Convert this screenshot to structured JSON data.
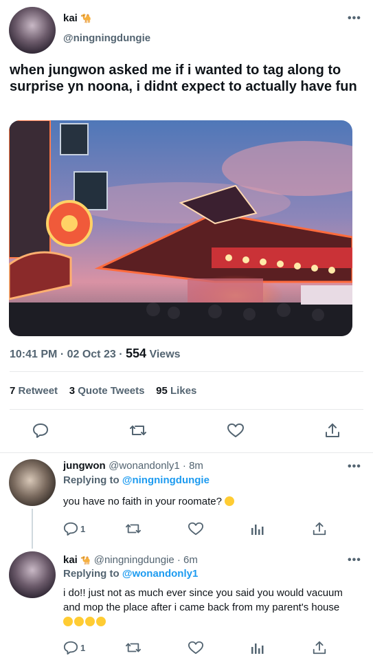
{
  "main_tweet": {
    "display_name": "kai",
    "name_emoji": "🐪",
    "handle": "@ningningdungie",
    "text": "when jungwon asked me if i wanted to tag along to surprise yn noona, i didnt expect to actually have fun",
    "time": "10:41 PM · 02 Oct 23 ·",
    "views_count": "554",
    "views_label": "Views",
    "retweets_count": "7",
    "retweets_label": "Retweet",
    "quotes_count": "3",
    "quotes_label": "Quote Tweets",
    "likes_count": "95",
    "likes_label": "Likes"
  },
  "replies": [
    {
      "display_name": "jungwon",
      "handle_time": "@wonandonly1 · 8m",
      "replying_prefix": "Replying to",
      "replying_to": "@ningningdungie",
      "text": "you have no faith in your roomate?",
      "reply_count": "1"
    },
    {
      "display_name": "kai",
      "name_emoji": "🐪",
      "handle_time": "@ningningdungie · 6m",
      "replying_prefix": "Replying to",
      "replying_to": "@wonandonly1",
      "text": "i do!! just not as much ever since you said you would vacuum and mop the place after i came back from my parent's house",
      "reply_count": "1"
    }
  ],
  "colors": {
    "accent": "#1d9bf0",
    "muted": "#536471",
    "text": "#0f1419",
    "divider": "#e7e9ea"
  },
  "icons": [
    "more-icon",
    "reply-icon",
    "retweet-icon",
    "like-icon",
    "share-icon",
    "views-icon"
  ]
}
